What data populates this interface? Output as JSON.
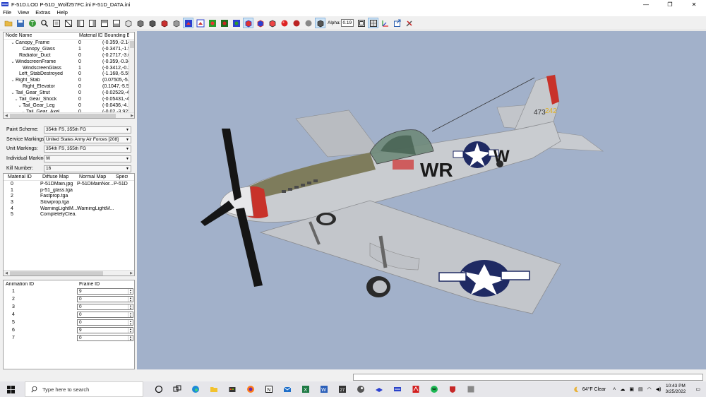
{
  "window": {
    "title": "F-51D.LOD  P-51D_Wolf257FC.ini  F-51D_DATA.ini",
    "minimize_glyph": "—",
    "maximize_glyph": "❐",
    "close_glyph": "✕"
  },
  "menu": [
    "File",
    "View",
    "Extras",
    "Help"
  ],
  "toolbar": {
    "alpha_label": "Alpha:",
    "alpha_value": "0.19"
  },
  "node_tree": {
    "headers": [
      "Node Name",
      "Material ID",
      "Bounding B"
    ],
    "rows": [
      {
        "chev": "⌄",
        "name": "Canopy_Frame",
        "mat": "0",
        "bb": "(-0.359,-2.14",
        "indent": 1
      },
      {
        "chev": "",
        "name": "Canopy_Glass",
        "mat": "1",
        "bb": "(-0.3471,-1.9",
        "indent": 3
      },
      {
        "chev": "",
        "name": "Radiator_Duct",
        "mat": "0",
        "bb": "(-0.2717,-3.0",
        "indent": 2
      },
      {
        "chev": "⌄",
        "name": "WindscreenFrame",
        "mat": "0",
        "bb": "(-0.359,-0.34",
        "indent": 1
      },
      {
        "chev": "",
        "name": "WindscreenGlass",
        "mat": "1",
        "bb": "(-0.3412,-0.2",
        "indent": 3
      },
      {
        "chev": "",
        "name": "Left_StabDestroyed",
        "mat": "0",
        "bb": "(-1.168,-5.55",
        "indent": 2
      },
      {
        "chev": "⌄",
        "name": "Right_Stab",
        "mat": "0",
        "bb": "(0.07505,-5.5",
        "indent": 1
      },
      {
        "chev": "",
        "name": "Right_Elevator",
        "mat": "0",
        "bb": "(0.1047,-5.53",
        "indent": 3
      },
      {
        "chev": "⌄",
        "name": "Tail_Gear_Strut",
        "mat": "0",
        "bb": "(-0.02529,-4.",
        "indent": 1
      },
      {
        "chev": "⌄",
        "name": "Tail_Gear_Shock",
        "mat": "0",
        "bb": "(-0.05431,-4.",
        "indent": 2
      },
      {
        "chev": "⌄",
        "name": "Tail_Gear_Leg",
        "mat": "0",
        "bb": "(-0.0436,-4.1",
        "indent": 3
      },
      {
        "chev": "⌄",
        "name": "Tail_Gear_Axel",
        "mat": "0",
        "bb": "(-0.02,-3.922",
        "indent": 4
      }
    ]
  },
  "schemes": [
    {
      "label": "Paint Scheme:",
      "value": "354th FS, 355th FG"
    },
    {
      "label": "Service Markings:",
      "value": "United States Army Air Forces [208]"
    },
    {
      "label": "Unit Markings:",
      "value": "354th FS, 355th FG"
    },
    {
      "label": "Individual Markings:",
      "value": "W"
    },
    {
      "label": "Kill Number:",
      "value": "16"
    }
  ],
  "materials": {
    "headers": [
      "Material ID",
      "Diffuse Map",
      "Normal Map",
      "Specu"
    ],
    "rows": [
      {
        "id": "0",
        "diffuse": "P-51DMain.jpg",
        "normal": "P-51DMainNor...",
        "spec": "P-51D"
      },
      {
        "id": "1",
        "diffuse": "p-51_glass.tga",
        "normal": "",
        "spec": ""
      },
      {
        "id": "2",
        "diffuse": "Fastprop.tga",
        "normal": "",
        "spec": ""
      },
      {
        "id": "3",
        "diffuse": "Slowprop.tga",
        "normal": "",
        "spec": ""
      },
      {
        "id": "4",
        "diffuse": "WarningLightM...",
        "normal": "WarningLightM...",
        "spec": ""
      },
      {
        "id": "5",
        "diffuse": "CompletelyClea...",
        "normal": "",
        "spec": ""
      }
    ]
  },
  "animations": {
    "headers": [
      "Animation ID",
      "Frame ID"
    ],
    "rows": [
      {
        "id": "1",
        "frame": "9"
      },
      {
        "id": "2",
        "frame": "0"
      },
      {
        "id": "3",
        "frame": "0"
      },
      {
        "id": "4",
        "frame": "0"
      },
      {
        "id": "5",
        "frame": "0"
      },
      {
        "id": "6",
        "frame": "9"
      },
      {
        "id": "7",
        "frame": "0"
      }
    ]
  },
  "viewport": {
    "code_main": "WR",
    "code_right": "W",
    "serial": "473",
    "tail_num": "242",
    "colors": {
      "background": "#a2b1ca",
      "fuselage": "#c9ccd0",
      "olive": "#7e7c5c",
      "red": "#c8322a",
      "roundel": "#1f2a63"
    }
  },
  "taskbar": {
    "search_placeholder": "Type here to search",
    "weather": "64°F  Clear",
    "time": "10:43 PM",
    "date": "3/25/2022",
    "icons": [
      "task-view-icon",
      "edge-icon",
      "file-explorer-icon",
      "store-icon",
      "firefox-icon",
      "notion-icon",
      "mail-icon",
      "excel-icon",
      "word-icon",
      "calendar-icon",
      "steam-icon",
      "app-icon-a",
      "app-icon-b",
      "pdf-icon",
      "spotify-icon",
      "shield-icon",
      "app-icon-c"
    ]
  }
}
